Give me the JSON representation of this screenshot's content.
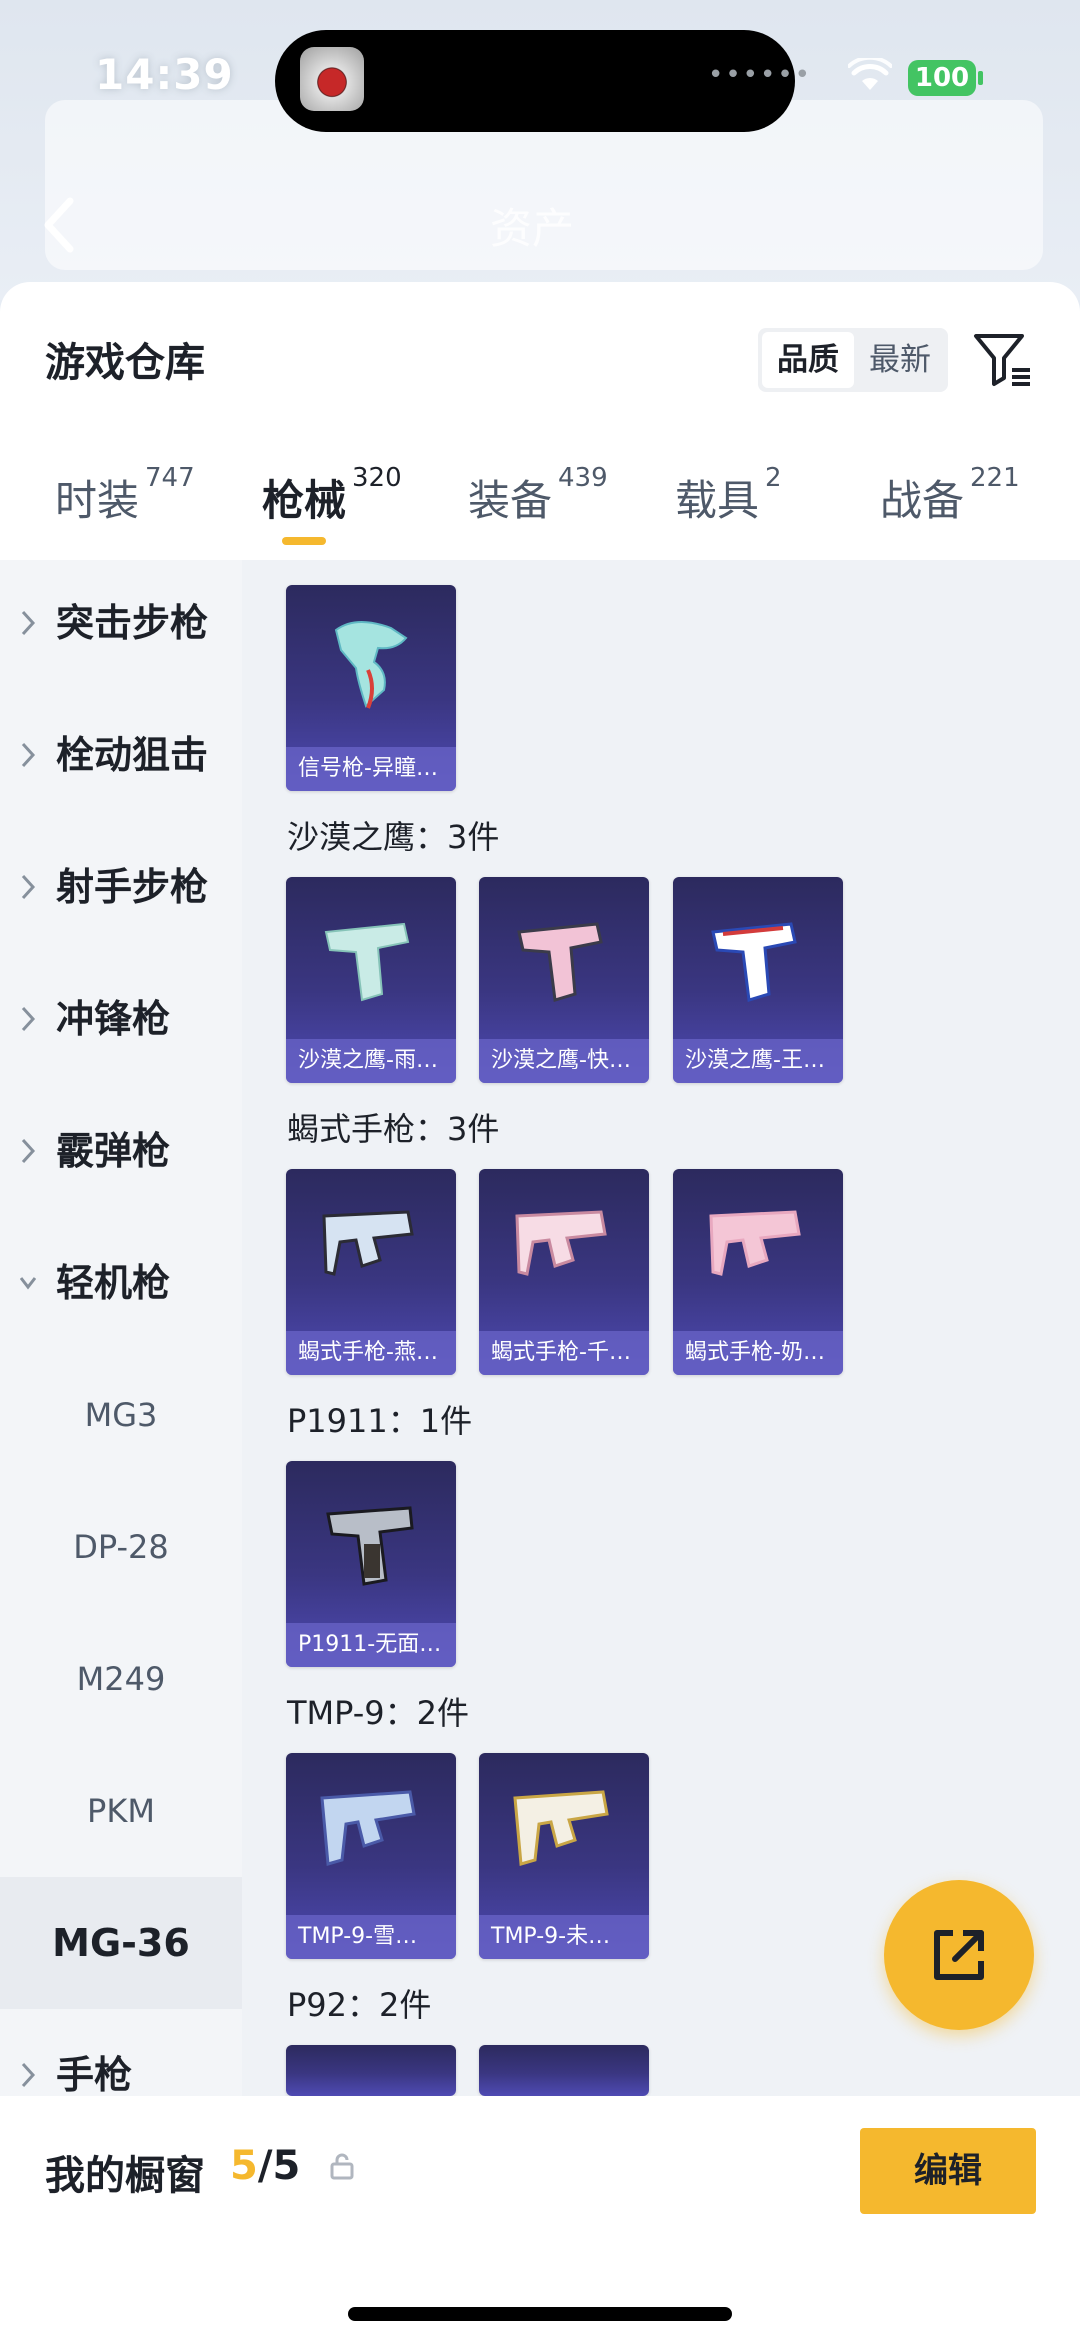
{
  "status": {
    "time": "14:39",
    "battery": "100",
    "dots": "••••••"
  },
  "background_header": {
    "title": "资产"
  },
  "sheet": {
    "title": "游戏仓库",
    "sort": {
      "quality": "品质",
      "newest": "最新"
    }
  },
  "tabs": [
    {
      "label": "时装",
      "count": "747"
    },
    {
      "label": "枪械",
      "count": "320"
    },
    {
      "label": "装备",
      "count": "439"
    },
    {
      "label": "载具",
      "count": "2"
    },
    {
      "label": "战备",
      "count": "221"
    }
  ],
  "sidenav": {
    "items": [
      "突击步枪",
      "栓动狙击",
      "射手步枪",
      "冲锋枪",
      "霰弹枪",
      "轻机枪"
    ],
    "sub_items": [
      "MG3",
      "DP-28",
      "M249",
      "PKM",
      "MG-36"
    ],
    "last": "手枪"
  },
  "groups": [
    {
      "label": "",
      "items": [
        "信号枪-异瞳…"
      ]
    },
    {
      "label": "沙漠之鹰：3件",
      "items": [
        "沙漠之鹰-雨…",
        "沙漠之鹰-快…",
        "沙漠之鹰-王…"
      ]
    },
    {
      "label": "蝎式手枪：3件",
      "items": [
        "蝎式手枪-燕…",
        "蝎式手枪-千…",
        "蝎式手枪-奶…"
      ]
    },
    {
      "label": "P1911：1件",
      "items": [
        "P1911-无面…"
      ]
    },
    {
      "label": "TMP-9：2件",
      "items": [
        "TMP-9-雪…",
        "TMP-9-未…"
      ]
    },
    {
      "label": "P92：2件",
      "items": [
        "",
        ""
      ]
    }
  ],
  "bottom": {
    "label": "我的橱窗",
    "used": "5",
    "total": "/5",
    "edit": "编辑"
  },
  "colors": {
    "accent": "#f5b82e",
    "card": "#3a3681"
  }
}
